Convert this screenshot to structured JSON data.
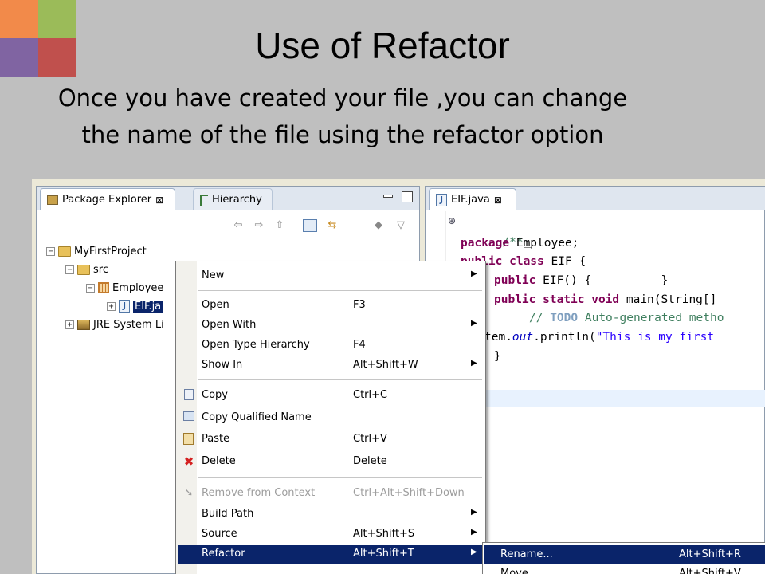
{
  "slide": {
    "title": "Use of Refactor",
    "subtitle_line1": "Once you have created your file ,you can change",
    "subtitle_line2": "the name of the file using the refactor option"
  },
  "package_explorer": {
    "tabs": [
      {
        "label": "Package Explorer",
        "close": "⊠"
      },
      {
        "label": "Hierarchy"
      }
    ],
    "tree": [
      {
        "label": "MyFirstProject",
        "expander": "−"
      },
      {
        "label": "src",
        "expander": "−"
      },
      {
        "label": "Employee",
        "expander": "−"
      },
      {
        "label": "EIF.ja",
        "expander": "+"
      },
      {
        "label": "JRE System Li",
        "expander": "+"
      }
    ]
  },
  "editor": {
    "tab_label": "EIF.java",
    "tab_close": "⊠",
    "fold_marker": "⊕",
    "lines": {
      "l1_comment": "/**",
      "l2_kw": "package",
      "l2_rest": " Employee;",
      "l3_kw": "public class",
      "l3_rest": " EIF {",
      "l4_kw": "public",
      "l4_rest": " EIF() {          }",
      "l5_kw": "public static void",
      "l5_rest": " main(String[]",
      "l6_comment": "// ",
      "l6_todo": "TODO",
      "l6_rest": " Auto-generated metho",
      "l7_pre": "tem.",
      "l7_it": "out",
      "l7_mid": ".println(",
      "l7_str": "\"This is my first",
      "l8": "}"
    }
  },
  "context_menu": {
    "items": [
      {
        "label": "New",
        "accel": "",
        "submenu": true
      },
      {
        "label": "Open",
        "accel": "F3"
      },
      {
        "label": "Open With",
        "accel": "",
        "submenu": true
      },
      {
        "label": "Open Type Hierarchy",
        "accel": "F4"
      },
      {
        "label": "Show In",
        "accel": "Alt+Shift+W",
        "submenu": true
      },
      {
        "label": "Copy",
        "accel": "Ctrl+C",
        "icon": "copy-icon"
      },
      {
        "label": "Copy Qualified Name",
        "accel": "",
        "icon": "copy-qualified-icon"
      },
      {
        "label": "Paste",
        "accel": "Ctrl+V",
        "icon": "paste-icon"
      },
      {
        "label": "Delete",
        "accel": "Delete",
        "icon": "delete-icon"
      },
      {
        "label": "Remove from Context",
        "accel": "Ctrl+Alt+Shift+Down",
        "disabled": true,
        "icon": "remove-context-icon"
      },
      {
        "label": "Build Path",
        "accel": "",
        "submenu": true
      },
      {
        "label": "Source",
        "accel": "Alt+Shift+S",
        "submenu": true
      },
      {
        "label": "Refactor",
        "accel": "Alt+Shift+T",
        "submenu": true,
        "highlighted": true
      }
    ],
    "arrow": "▶"
  },
  "refactor_submenu": {
    "items": [
      {
        "label": "Rename...",
        "accel": "Alt+Shift+R",
        "highlighted": true
      },
      {
        "label": "Move...",
        "accel": "Alt+Shift+V"
      }
    ]
  },
  "colors": {
    "highlight": "#0a246a",
    "keyword": "#7f0055",
    "comment": "#3f7f5f",
    "string": "#2a00ff"
  }
}
